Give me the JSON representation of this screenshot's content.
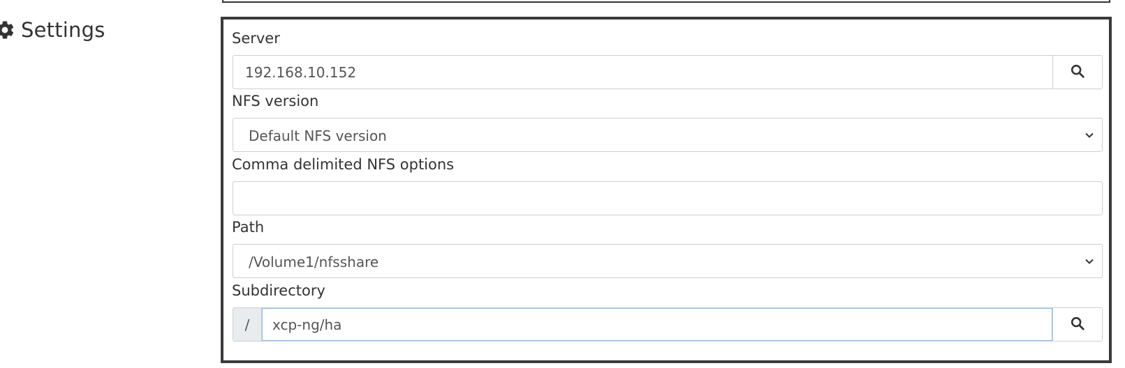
{
  "section": {
    "title": "Settings",
    "icon": "gear-icon"
  },
  "form": {
    "server": {
      "label": "Server",
      "value": "192.168.10.152",
      "button_icon": "search-icon"
    },
    "nfs_version": {
      "label": "NFS version",
      "selected": "Default NFS version",
      "icon": "chevron-down-icon"
    },
    "nfs_options": {
      "label": "Comma delimited NFS options",
      "value": ""
    },
    "path": {
      "label": "Path",
      "selected": "/Volume1/nfsshare",
      "icon": "chevron-down-icon"
    },
    "subdirectory": {
      "label": "Subdirectory",
      "prefix": "/",
      "value": "xcp-ng/ha",
      "button_icon": "search-icon"
    }
  },
  "colors": {
    "panel_border": "#3a3a3a",
    "input_border": "#cfcfcf",
    "addon_bg": "#e9ecef",
    "focus_border": "#80bdff",
    "text": "#333333"
  }
}
